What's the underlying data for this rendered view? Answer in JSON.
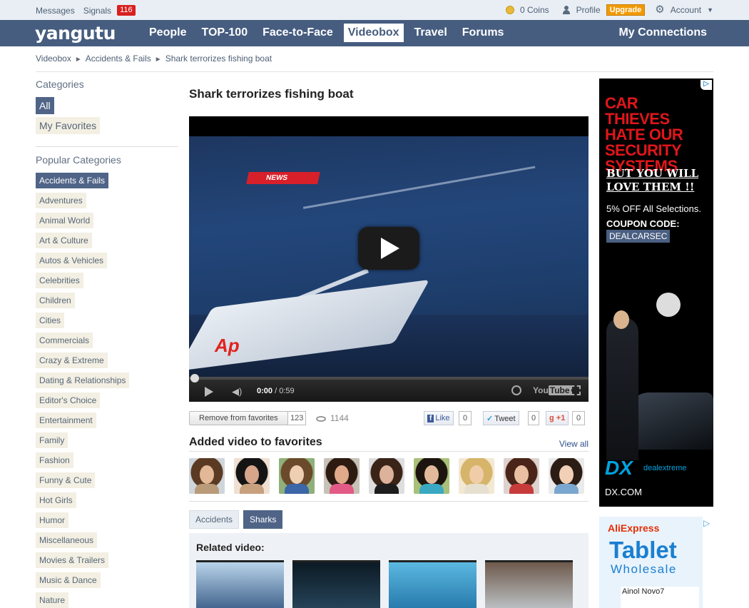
{
  "topbar": {
    "messages": "Messages",
    "signals": "Signals",
    "signals_count": "116",
    "coins": "0 Coins",
    "profile": "Profile",
    "upgrade": "Upgrade",
    "account": "Account"
  },
  "nav": {
    "logo": "yangutu",
    "items": [
      "People",
      "TOP-100",
      "Face-to-Face",
      "Videobox",
      "Travel",
      "Forums"
    ],
    "active_index": 3,
    "connections": "My Connections"
  },
  "breadcrumb": [
    "Videobox",
    "Accidents & Fails",
    "Shark terrorizes fishing boat"
  ],
  "sidebar": {
    "categories_title": "Categories",
    "all": "All",
    "favorites": "My Favorites",
    "popular_title": "Popular Categories",
    "items": [
      "Accidents & Fails",
      "Adventures",
      "Animal World",
      "Art & Culture",
      "Autos & Vehicles",
      "Celebrities",
      "Children",
      "Cities",
      "Commercials",
      "Crazy & Extreme",
      "Dating & Relationships",
      "Editor's Choice",
      "Entertainment",
      "Family",
      "Fashion",
      "Funny & Cute",
      "Hot Girls",
      "Humor",
      "Miscellaneous",
      "Movies & Trailers",
      "Music & Dance",
      "Nature"
    ],
    "selected_index": 0
  },
  "video": {
    "title": "Shark terrorizes fishing boat",
    "news_badge": "NEWS",
    "ap_logo": "Ap",
    "time_current": "0:00",
    "time_total": "0:59",
    "progress": 0
  },
  "actions": {
    "remove_label": "Remove from favorites",
    "fav_count": "123",
    "views": "1144",
    "like": "Like",
    "like_count": "0",
    "tweet": "Tweet",
    "tweet_count": "0",
    "gplus": "+1",
    "gplus_count": "0"
  },
  "favorites": {
    "heading": "Added video to favorites",
    "view_all": "View all",
    "faces": [
      {
        "hair": "#5a3a22",
        "skin": "#e3b896",
        "body": "#b99b7a",
        "bg": "#cfd6db"
      },
      {
        "hair": "#141414",
        "skin": "#d7a58a",
        "body": "#c8a07e",
        "bg": "#efe0d2"
      },
      {
        "hair": "#6b4a2c",
        "skin": "#efcfb2",
        "body": "#3b66a8",
        "bg": "#8fb07a"
      },
      {
        "hair": "#2d1b12",
        "skin": "#e0a98a",
        "body": "#e25a86",
        "bg": "#c7c2b6"
      },
      {
        "hair": "#3a2418",
        "skin": "#dcb29a",
        "body": "#1d1d1d",
        "bg": "#dedede"
      },
      {
        "hair": "#1d1410",
        "skin": "#e3b99b",
        "body": "#3aa8c2",
        "bg": "#a9c07a"
      },
      {
        "hair": "#d6b46a",
        "skin": "#f0cda8",
        "body": "#e6e0d0",
        "bg": "#f3e8d2"
      },
      {
        "hair": "#4a2418",
        "skin": "#eac0a3",
        "body": "#c83b3b",
        "bg": "#ddd2ce"
      },
      {
        "hair": "#2b1c14",
        "skin": "#f1d0b6",
        "body": "#7aa7cf",
        "bg": "#eaeaea"
      }
    ]
  },
  "tags": [
    "Accidents",
    "Sharks"
  ],
  "tags_selected": 1,
  "related": {
    "heading": "Related video:",
    "thumbs": [
      {
        "top": "#b9d4ea",
        "bottom": "#2b4e7c"
      },
      {
        "top": "#0c1a24",
        "bottom": "#2a4b62"
      },
      {
        "top": "#5bb8e0",
        "bottom": "#1d6fa3"
      },
      {
        "top": "#6e5a4c",
        "bottom": "#c9d3d9"
      }
    ]
  },
  "ads": {
    "ad1": {
      "headline": "CAR THIEVES HATE OUR SECURITY SYSTEMS",
      "sub": "BUT YOU WILL LOVE THEM !!",
      "promo": "5% OFF All Selections.",
      "coupon_label": "COUPON CODE:",
      "coupon": "DEALCARSEC",
      "brand": "DX",
      "brand_sub": "dealextreme",
      "url": "DX.COM"
    },
    "ad2": {
      "brand": "AliExpress",
      "headline": "Tablet",
      "sub": "Wholesale",
      "product": "Ainol Novo7"
    }
  }
}
